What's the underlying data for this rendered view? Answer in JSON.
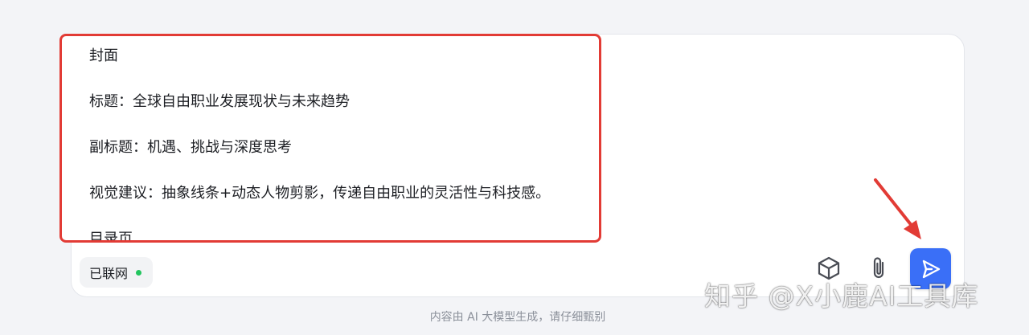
{
  "prompt": {
    "lines": [
      "封面",
      "标题：全球自由职业发展现状与未来趋势",
      "副标题：机遇、挑战与深度思考",
      "视觉建议：抽象线条+动态人物剪影，传递自由职业的灵活性与科技感。",
      "目录页"
    ]
  },
  "toolbar": {
    "network_label": "已联网",
    "network_status_color": "#22c55e",
    "icons": {
      "cube": "cube-icon",
      "attach": "paperclip-icon",
      "send": "send-icon"
    },
    "send_color": "#3a6ff7"
  },
  "annotation": {
    "highlight_color": "#e23b35"
  },
  "footer": {
    "disclaimer": "内容由 AI 大模型生成，请仔细甄别"
  },
  "watermark": {
    "text": "知乎 @X小鹿AI工具库"
  }
}
